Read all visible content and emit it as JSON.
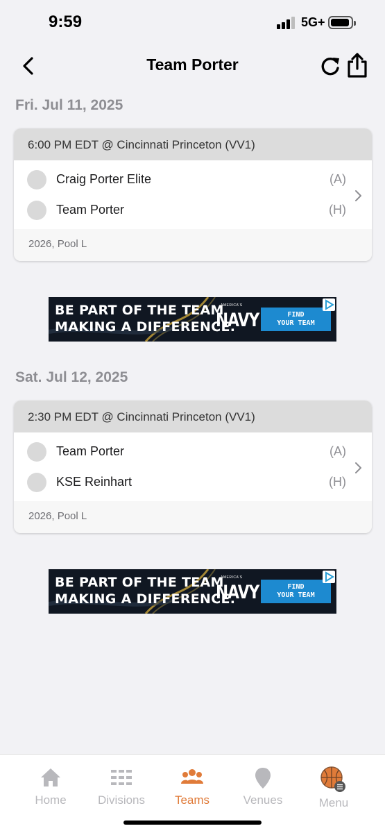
{
  "status_bar": {
    "time": "9:59",
    "network": "5G+"
  },
  "nav": {
    "title": "Team Porter",
    "back_icon": "chevron-left-icon",
    "refresh_icon": "refresh-icon",
    "share_icon": "share-icon"
  },
  "days": [
    {
      "date": "Fri. Jul 11, 2025",
      "game": {
        "time_location": "6:00 PM EDT @ Cincinnati Princeton (VV1)",
        "teams": [
          {
            "name": "Craig Porter Elite",
            "side": "(A)"
          },
          {
            "name": "Team Porter",
            "side": "(H)"
          }
        ],
        "pool": "2026, Pool L"
      }
    },
    {
      "date": "Sat. Jul 12, 2025",
      "game": {
        "time_location": "2:30 PM EDT @ Cincinnati Princeton (VV1)",
        "teams": [
          {
            "name": "Team Porter",
            "side": "(A)"
          },
          {
            "name": "KSE Reinhart",
            "side": "(H)"
          }
        ],
        "pool": "2026, Pool L"
      }
    }
  ],
  "ad": {
    "line1": "BE PART OF THE TEAM",
    "line2": "MAKING A DIFFERENCE.",
    "brand_small": "AMERICA'S",
    "brand": "NAVY",
    "cta_line1": "FIND",
    "cta_line2": "YOUR TEAM"
  },
  "tabs": [
    {
      "label": "Home",
      "icon": "home-icon",
      "active": false
    },
    {
      "label": "Divisions",
      "icon": "list-icon",
      "active": false
    },
    {
      "label": "Teams",
      "icon": "people-icon",
      "active": true
    },
    {
      "label": "Venues",
      "icon": "location-pin-icon",
      "active": false
    },
    {
      "label": "Menu",
      "icon": "basketball-menu-icon",
      "active": false
    }
  ],
  "colors": {
    "accent": "#e07b39",
    "inactive": "#b8b8bc",
    "background": "#f2f2f5"
  }
}
